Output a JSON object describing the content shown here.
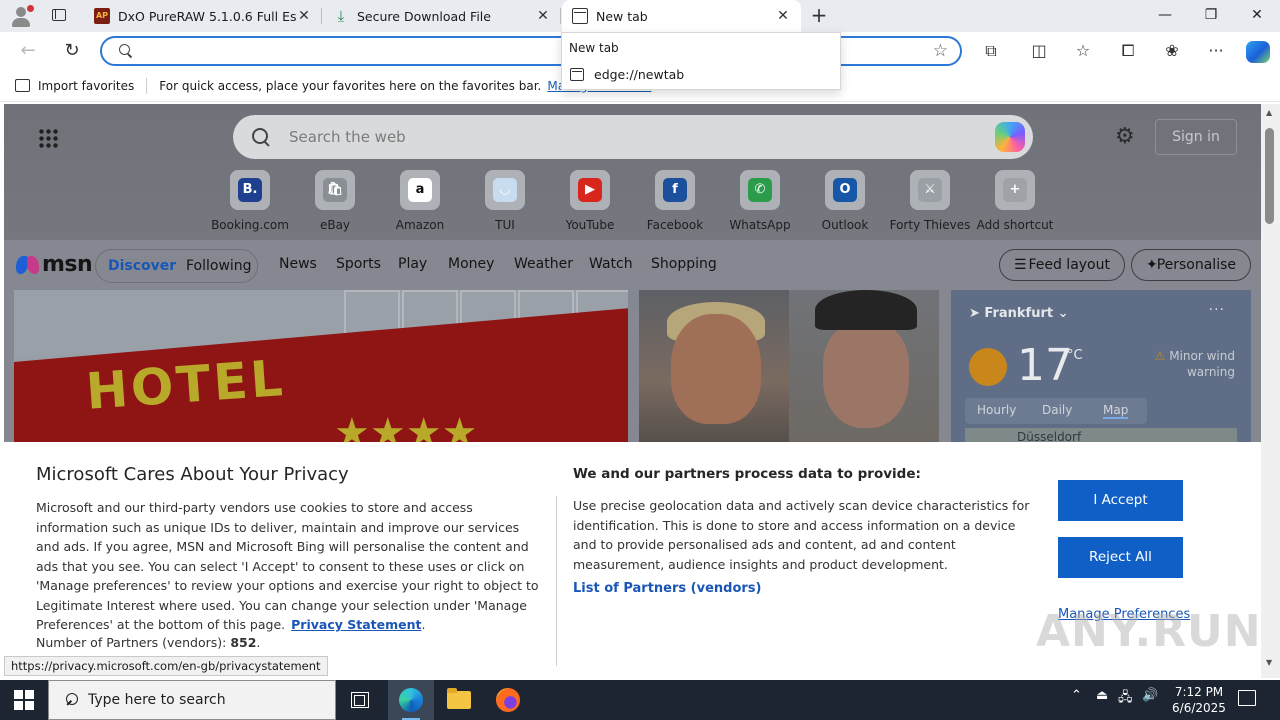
{
  "tabs": [
    {
      "title": "DxO PureRAW 5.1.0.6 Full Español",
      "favicon": "dxo-app-icon",
      "favicon_text": "AP",
      "active": false
    },
    {
      "title": "Secure Download File",
      "favicon": "download-icon",
      "favicon_glyph": "⤓",
      "active": false
    },
    {
      "title": "New tab",
      "favicon": "newtab-page-icon",
      "active": true
    }
  ],
  "window_controls": {
    "minimize": "—",
    "restore": "❐",
    "close": "✕"
  },
  "tab_close_glyph": "✕",
  "new_tab_glyph": "+",
  "nav": {
    "back": "←",
    "refresh": "↻"
  },
  "omnibox": {
    "value": "",
    "star": "☆"
  },
  "toolbar_icons": {
    "extensions": "⧉",
    "split_screen": "◫",
    "favorites": "☆",
    "collections": "⧠",
    "performance": "❀",
    "more": "···"
  },
  "suggestion": {
    "label": "New tab",
    "url": "edge://newtab"
  },
  "favorites_bar": {
    "import_label": "Import favorites",
    "hint": "For quick access, place your favorites here on the favorites bar.",
    "manage_link": "Manage favorites"
  },
  "ntp": {
    "search_placeholder": "Search the web",
    "gear": "⚙",
    "sign_in": "Sign in",
    "shortcuts": [
      {
        "label": "Booking.com",
        "glyph": "B.",
        "color": "#1f3f8f"
      },
      {
        "label": "eBay",
        "glyph": "🛍",
        "color": "#8a8f96"
      },
      {
        "label": "Amazon",
        "glyph": "a",
        "color": "#ffffff"
      },
      {
        "label": "TUI",
        "glyph": "◡",
        "color": "#c8dcef"
      },
      {
        "label": "YouTube",
        "glyph": "▶",
        "color": "#d8261d"
      },
      {
        "label": "Facebook",
        "glyph": "f",
        "color": "#1c4f9c"
      },
      {
        "label": "WhatsApp",
        "glyph": "✆",
        "color": "#2a9c4b"
      },
      {
        "label": "Outlook",
        "glyph": "O",
        "color": "#1757a8"
      },
      {
        "label": "Forty Thieves",
        "glyph": "⚔",
        "color": "#9aa0a6"
      },
      {
        "label": "Add shortcut",
        "glyph": "+",
        "color": "#9fa3a8"
      }
    ]
  },
  "msn": {
    "logo_text": "msn",
    "pills": {
      "discover": "Discover",
      "following": "Following"
    },
    "nav": [
      "News",
      "Sports",
      "Play",
      "Money",
      "Weather",
      "Watch",
      "Shopping"
    ],
    "feed_layout": "Feed layout",
    "personalise": "Personalise",
    "hotel_sign": "HOTEL",
    "stars": "★★★★",
    "weather": {
      "location": "Frankfurt",
      "temp": "17",
      "unit": "°C",
      "warning": "Minor wind warning",
      "tabs": [
        "Hourly",
        "Daily",
        "Map"
      ],
      "map_label": "Düsseldorf",
      "more": "···"
    }
  },
  "privacy": {
    "title": "Microsoft Cares About Your Privacy",
    "body": "Microsoft and our third-party vendors use cookies to store and access information such as unique IDs to deliver, maintain and improve our services and ads. If you agree, MSN and Microsoft Bing will personalise the content and ads that you see. You can select 'I Accept' to consent to these uses or click on 'Manage preferences' to review your options and exercise your right to object to Legitimate Interest where used.  You can change your selection under 'Manage Preferences' at the bottom of this page.",
    "privacy_link": "Privacy Statement",
    "partners_label": "Number of Partners (vendors):",
    "partners_count": "852",
    "purposes_title": "We and our partners process data to provide:",
    "purposes_body": "Use precise geolocation data and actively scan device characteristics for identification. This is done to store and access information on a device and to provide personalised ads and content, ad and content measurement, audience insights and product development.",
    "list_partners": "List of Partners (vendors)",
    "accept": "I Accept",
    "reject": "Reject All",
    "manage": "Manage Preferences"
  },
  "status_url": "https://privacy.microsoft.com/en-gb/privacystatement",
  "watermark": "ANY.RUN",
  "taskbar": {
    "search_placeholder": "Type here to search",
    "apps": [
      "task-view",
      "edge",
      "file-explorer",
      "firefox"
    ],
    "tray": {
      "chevron": "⌃",
      "usb": "⏏",
      "network": "🖧",
      "volume": "🔊"
    },
    "time": "7:12 PM",
    "date": "6/6/2025"
  },
  "colors": {
    "accent": "#0f5fc7",
    "link": "#1a56b8",
    "omnibox_border": "#2b79d6"
  }
}
